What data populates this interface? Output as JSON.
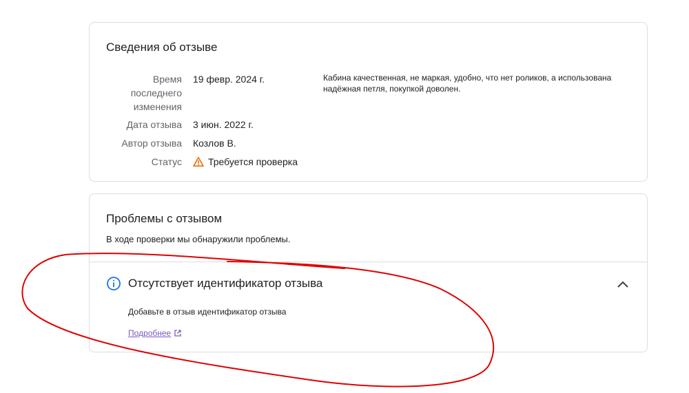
{
  "details": {
    "title": "Сведения об отзыве",
    "rows": [
      {
        "label": "Время последнего изменения",
        "value": "19 февр. 2024 г."
      },
      {
        "label": "Дата отзыва",
        "value": "3 июн. 2022 г."
      },
      {
        "label": "Автор отзыва",
        "value": "Козлов В."
      },
      {
        "label": "Статус",
        "value": "Требуется проверка"
      }
    ],
    "review_text": "Кабина качественная, не маркая, удобно, что нет роликов, а использована надёжная петля, покупкой доволен."
  },
  "problems": {
    "title": "Проблемы с отзывом",
    "subtitle": "В ходе проверки мы обнаружили проблемы.",
    "issue": {
      "title": "Отсутствует идентификатор отзыва",
      "description": "Добавьте в отзыв идентификатор отзыва",
      "link": "Подробнее"
    }
  },
  "colors": {
    "warning": "#e8710a",
    "info": "#1a73e8",
    "link": "#7e57c2",
    "annotation": "#e00000"
  },
  "icons": {
    "status": "warning-triangle-icon",
    "issue": "info-icon",
    "expand": "chevron-up-icon",
    "link": "external-link-icon"
  }
}
